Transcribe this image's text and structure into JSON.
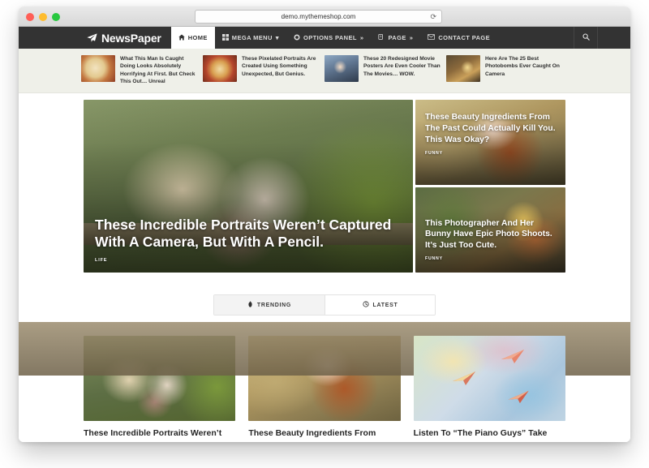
{
  "browser": {
    "url": "demo.mythemeshop.com",
    "reload_icon": "reload-icon",
    "new_tab_icon": "plus-icon",
    "traffic_lights": [
      "close",
      "minimize",
      "maximize"
    ]
  },
  "site": {
    "logo_text": "NewsPaper",
    "logo_icon": "paper-plane-icon",
    "nav": [
      {
        "label": "HOME",
        "icon": "home-icon",
        "active": true,
        "suffix": ""
      },
      {
        "label": "MEGA MENU",
        "icon": "grid-icon",
        "active": false,
        "suffix": "▾"
      },
      {
        "label": "OPTIONS PANEL",
        "icon": "gear-icon",
        "active": false,
        "suffix": "»"
      },
      {
        "label": "PAGE",
        "icon": "pages-icon",
        "active": false,
        "suffix": "»"
      },
      {
        "label": "CONTACT PAGE",
        "icon": "envelope-icon",
        "active": false,
        "suffix": ""
      }
    ],
    "search_icon": "search-icon"
  },
  "featured_strip": [
    {
      "title": "What This Man Is Caught Doing Looks Absolutely Horrifying At First. But Check This Out… Unreal",
      "thumb": "img-pasta"
    },
    {
      "title": "These Pixelated Portraits Are Created Using Something Unexpected, But Genius.",
      "thumb": "img-pizza"
    },
    {
      "title": "These 20 Redesigned Movie Posters Are Even Cooler Than The Movies… WOW.",
      "thumb": "img-portrait"
    },
    {
      "title": "Here Are The 25 Best Photobombs Ever Caught On Camera",
      "thumb": "img-photobomb"
    }
  ],
  "hero": {
    "main": {
      "title": "These Incredible Portraits Weren’t Captured With A Camera, But With A Pencil.",
      "category": "LIFE",
      "image": "img-couple"
    },
    "side": [
      {
        "title": "These Beauty Ingredients From The Past Could Actually Kill You. This Was Okay?",
        "category": "FUNNY",
        "image": "img-beauty"
      },
      {
        "title": "This Photographer And Her Bunny Have Epic Photo Shoots. It’s Just Too Cute.",
        "category": "FUNNY",
        "image": "img-bunny"
      }
    ]
  },
  "tabs": [
    {
      "label": "TRENDING",
      "icon": "fire-icon",
      "active": true
    },
    {
      "label": "LATEST",
      "icon": "clock-icon",
      "active": false
    }
  ],
  "posts": [
    {
      "title": "These Incredible Portraits Weren’t",
      "image": "img-couple"
    },
    {
      "title": "These Beauty Ingredients From",
      "image": "img-beauty"
    },
    {
      "title": "Listen To “The Piano Guys” Take",
      "image": "img-planes"
    }
  ],
  "colors": {
    "nav_bg": "#333333",
    "strip_bg": "#eff0e9",
    "page_bg": "#ffffff",
    "text_dark": "#262626",
    "tab_active_bg": "#f3f3f3"
  }
}
